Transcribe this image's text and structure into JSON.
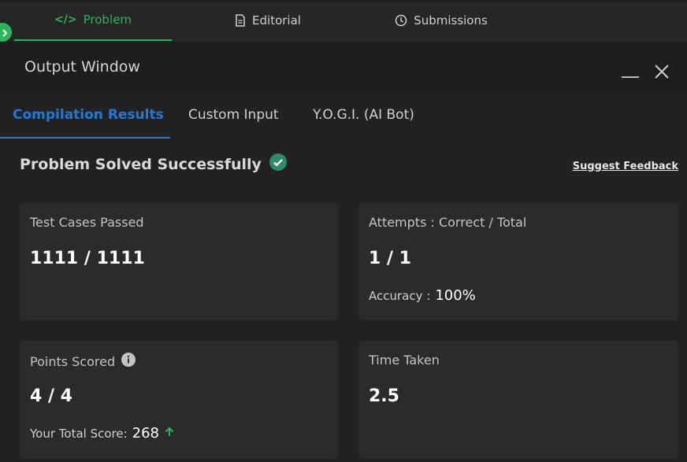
{
  "top_tabs": [
    {
      "label": "Problem",
      "icon": "code-icon",
      "active": true
    },
    {
      "label": "Editorial",
      "icon": "document-icon",
      "active": false
    },
    {
      "label": "Submissions",
      "icon": "clock-icon",
      "active": false
    }
  ],
  "output_window": {
    "title": "Output Window"
  },
  "sub_tabs": [
    {
      "label": "Compilation Results",
      "active": true
    },
    {
      "label": "Custom Input",
      "active": false
    },
    {
      "label": "Y.O.G.I. (AI Bot)",
      "active": false
    }
  ],
  "status": {
    "text": "Problem Solved Successfully",
    "icon": "check-circle-icon"
  },
  "feedback_link": "Suggest Feedback",
  "cards": {
    "test_cases": {
      "label": "Test Cases Passed",
      "value": "1111 / 1111"
    },
    "attempts": {
      "label": "Attempts : Correct / Total",
      "value": "1 / 1",
      "accuracy_label": "Accuracy :",
      "accuracy_value": "100%"
    },
    "points": {
      "label": "Points Scored",
      "value": "4 / 4",
      "total_label": "Your Total Score:",
      "total_value": "268"
    },
    "time": {
      "label": "Time Taken",
      "value": "2.5"
    }
  },
  "colors": {
    "accent_green": "#2cb55d",
    "accent_blue": "#1f7ae0",
    "background": "#222222",
    "card": "#2b2b2b"
  }
}
